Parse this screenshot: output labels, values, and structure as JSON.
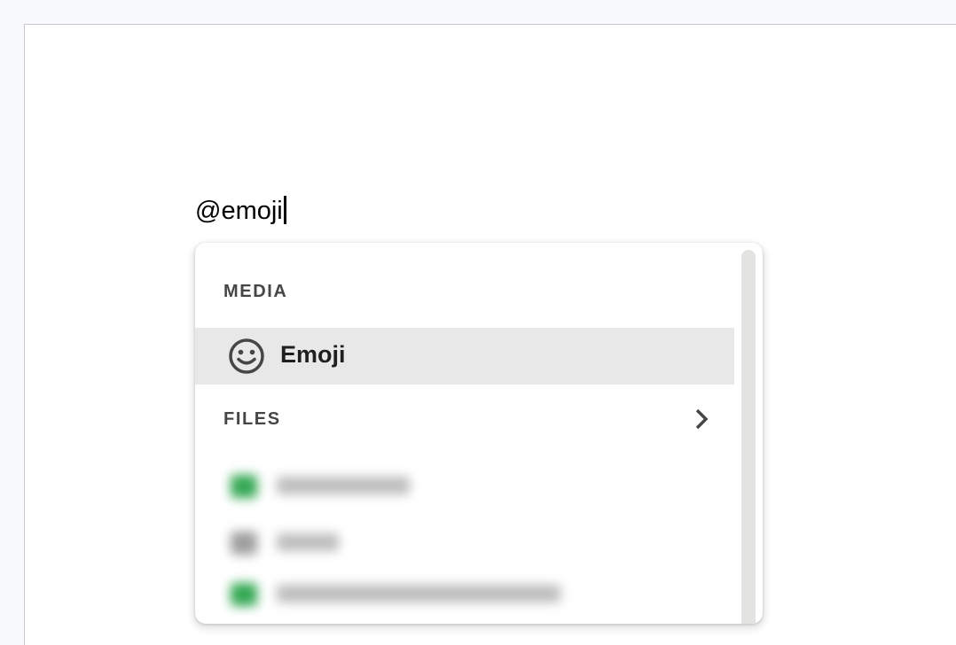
{
  "editor": {
    "typed_text": "@emoji"
  },
  "popup": {
    "media_section": {
      "header": "MEDIA",
      "items": [
        {
          "label": "Emoji",
          "icon": "smiley-face-icon",
          "selected": true
        }
      ]
    },
    "files_section": {
      "header": "FILES",
      "icon": "chevron-right-icon"
    },
    "blurred_items": [
      {
        "icon": "sheets-file-icon",
        "icon_color": "#34a853"
      },
      {
        "icon": "folder-icon",
        "icon_color": "#9e9e9e"
      },
      {
        "icon": "sheets-file-icon",
        "icon_color": "#34a853"
      }
    ]
  },
  "colors": {
    "selected_item_bg": "#e8e8e8",
    "section_header": "#444746",
    "scrollbar": "#e3e4e2",
    "page_bg": "#f8f9fc"
  }
}
